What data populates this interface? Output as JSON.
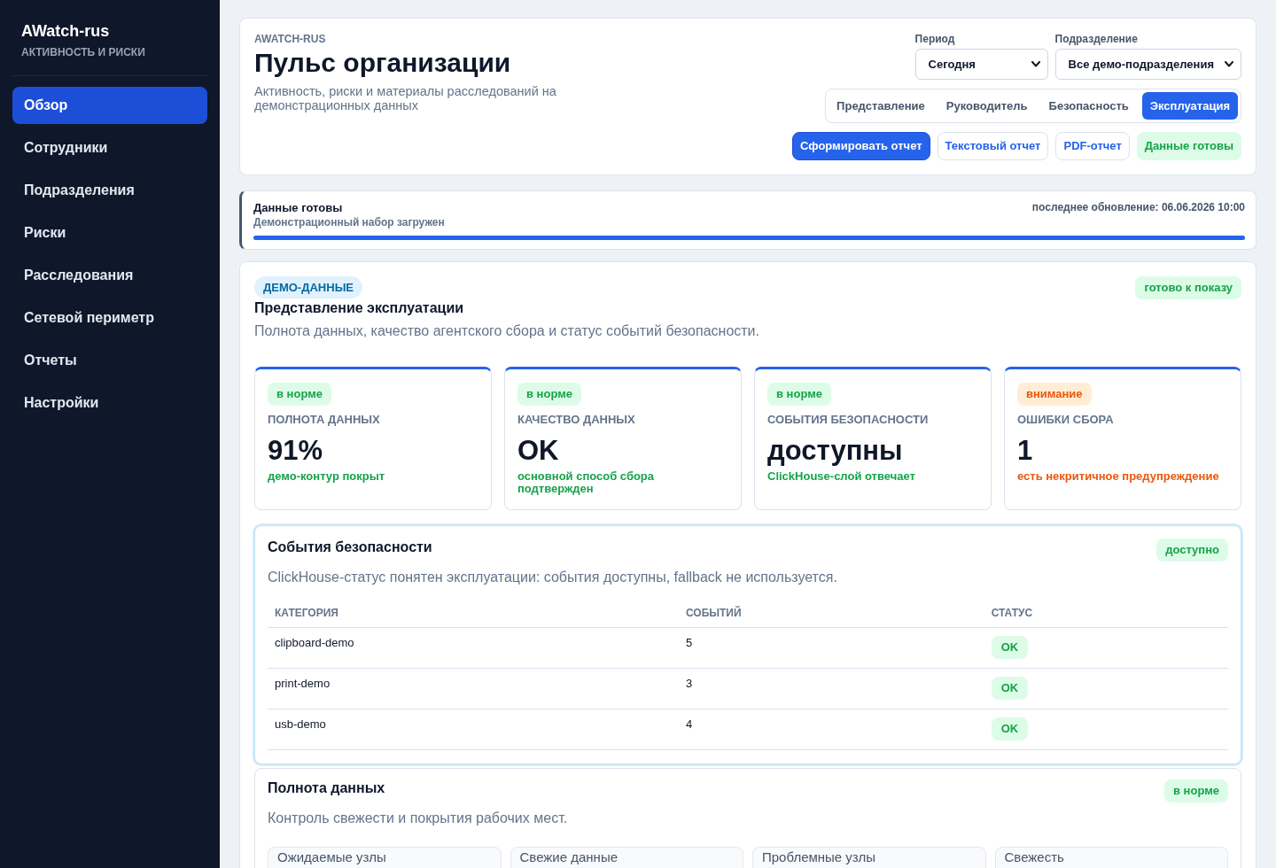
{
  "sidebar": {
    "brand": "AWatch-rus",
    "subtitle": "АКТИВНОСТЬ И РИСКИ",
    "items": [
      {
        "label": "Обзор",
        "selected": true
      },
      {
        "label": "Сотрудники",
        "selected": false
      },
      {
        "label": "Подразделения",
        "selected": false
      },
      {
        "label": "Риски",
        "selected": false
      },
      {
        "label": "Расследования",
        "selected": false
      },
      {
        "label": "Сетевой периметр",
        "selected": false
      },
      {
        "label": "Отчеты",
        "selected": false
      },
      {
        "label": "Настройки",
        "selected": false
      }
    ]
  },
  "header": {
    "eyebrow": "AWATCH-RUS",
    "title": "Пульс организации",
    "description": "Активность, риски и материалы расследований на демонстрационных данных",
    "filters": [
      {
        "label": "Период",
        "value": "Сегодня"
      },
      {
        "label": "Подразделение",
        "value": "Все демо-подразделения"
      }
    ],
    "views": [
      {
        "label": "Представление",
        "selected": false
      },
      {
        "label": "Руководитель",
        "selected": false
      },
      {
        "label": "Безопасность",
        "selected": false
      },
      {
        "label": "Эксплуатация",
        "selected": true
      }
    ],
    "actions": [
      {
        "label": "Сформировать отчет",
        "kind": "primary"
      },
      {
        "label": "Текстовый отчет",
        "kind": "outline"
      },
      {
        "label": "PDF-отчет",
        "kind": "outline"
      },
      {
        "label": "Данные готовы",
        "kind": "success"
      }
    ]
  },
  "status_bar": {
    "title": "Данные готовы",
    "subtitle": "Демонстрационный набор загружен",
    "updated": "последнее обновление: 06.06.2026 10:00",
    "level": 1
  },
  "overview": {
    "tag": "ДЕМО-ДАННЫЕ",
    "badge": {
      "label": "готово к показу",
      "kind": "ok"
    },
    "title": "Представление эксплуатации",
    "description": "Полнота данных, качество агентского сбора и статус событий безопасности.",
    "kpis": [
      {
        "badge": {
          "label": "в норме",
          "kind": "ok"
        },
        "label": "ПОЛНОТА ДАННЫХ",
        "value": "91%",
        "note": "демо-контур покрыт"
      },
      {
        "badge": {
          "label": "в норме",
          "kind": "ok"
        },
        "label": "КАЧЕСТВО ДАННЫХ",
        "value": "OK",
        "note": "основной способ сбора подтвержден"
      },
      {
        "badge": {
          "label": "в норме",
          "kind": "ok"
        },
        "label": "СОБЫТИЯ БЕЗОПАСНОСТИ",
        "value": "доступны",
        "note": "ClickHouse-слой отвечает"
      },
      {
        "badge": {
          "label": "внимание",
          "kind": "warning"
        },
        "label": "ОШИБКИ СБОРА",
        "value": "1",
        "note": "есть некритичное предупреждение"
      }
    ]
  },
  "security_events": {
    "highlighted": true,
    "title": "События безопасности",
    "badge": {
      "label": "доступно",
      "kind": "ok"
    },
    "description": "ClickHouse-статус понятен эксплуатации: события доступны, fallback не используется.",
    "table": {
      "columns": [
        "КАТЕГОРИЯ",
        "СОБЫТИЙ",
        "СТАТУС"
      ],
      "rows": [
        {
          "category": "clipboard-demo",
          "events": "5",
          "status": {
            "label": "OK",
            "kind": "ok"
          }
        },
        {
          "category": "print-demo",
          "events": "3",
          "status": {
            "label": "OK",
            "kind": "ok"
          }
        },
        {
          "category": "usb-demo",
          "events": "4",
          "status": {
            "label": "OK",
            "kind": "ok"
          }
        }
      ]
    }
  },
  "data_completeness": {
    "highlighted": false,
    "title": "Полнота данных",
    "badge": {
      "label": "в норме",
      "kind": "ok"
    },
    "description": "Контроль свежести и покрытия рабочих мест.",
    "tiles": [
      {
        "label": "Ожидаемые узлы"
      },
      {
        "label": "Свежие данные"
      },
      {
        "label": "Проблемные узлы"
      },
      {
        "label": "Свежесть"
      }
    ]
  }
}
